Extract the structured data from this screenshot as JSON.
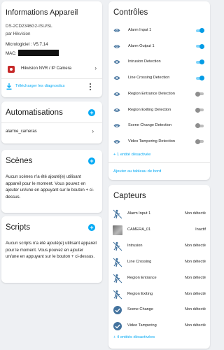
{
  "device": {
    "title": "Informations Appareil",
    "model": "DS-2CD2346G2-ISU/SL",
    "brand": "par Hikvision",
    "firmware": "Micrologiciel : V5.7.14",
    "mac_label": "MAC:",
    "integration": "Hikvision NVR / IP Camera",
    "download": "Télécharger les diagnostics"
  },
  "automations": {
    "title": "Automatisations",
    "items": [
      "alarme_cameras"
    ]
  },
  "scenes": {
    "title": "Scènes",
    "text": "Aucun scènes n'a été ajouté(e) utilisant appareil pour le moment. Vous pouvez en ajouter un/une en appuyant sur le bouton + ci-dessus."
  },
  "scripts": {
    "title": "Scripts",
    "text": "Aucun scripts n'a été ajouté(e) utilisant appareil pour le moment. Vous pouvez en ajouter un/une en appuyant sur le bouton + ci-dessus."
  },
  "controls": {
    "title": "Contrôles",
    "items": [
      {
        "label": "Alarm Input 1",
        "on": true
      },
      {
        "label": "Alarm Output 1",
        "on": true
      },
      {
        "label": "Intrusion Detection",
        "on": true
      },
      {
        "label": "Line Crossing Detection",
        "on": true
      },
      {
        "label": "Region Entrance Detection",
        "on": false
      },
      {
        "label": "Region Exiting Detection",
        "on": false
      },
      {
        "label": "Scene Change Detection",
        "on": false
      },
      {
        "label": "Video Tampering Detection",
        "on": false
      }
    ],
    "disabled_link": "+ 1 entité désactivée",
    "add_dashboard": "Ajouter au tableau de bord"
  },
  "sensors": {
    "title": "Capteurs",
    "items": [
      {
        "label": "Alarm Input 1",
        "state": "Non détecté",
        "icon": "motion-sensor-icon"
      },
      {
        "label": "CAMERA_01",
        "state": "Inactif",
        "icon": "camera-thumbnail"
      },
      {
        "label": "Intrusion",
        "state": "Non détecté",
        "icon": "motion-sensor-icon"
      },
      {
        "label": "Line Crossing",
        "state": "Non détecté",
        "icon": "motion-sensor-icon"
      },
      {
        "label": "Region Entrance",
        "state": "Non détecté",
        "icon": "motion-sensor-icon"
      },
      {
        "label": "Region Exiting",
        "state": "Non détecté",
        "icon": "motion-sensor-icon"
      },
      {
        "label": "Scene Change",
        "state": "Non détecté",
        "icon": "check-circle-icon"
      },
      {
        "label": "Video Tampering",
        "state": "Non détecté",
        "icon": "check-circle-icon"
      }
    ],
    "disabled_link": "+ 4 entités désactivées"
  },
  "colors": {
    "accent": "#03a9f4",
    "toggle_on": "#039be5",
    "icon": "#44739e"
  }
}
